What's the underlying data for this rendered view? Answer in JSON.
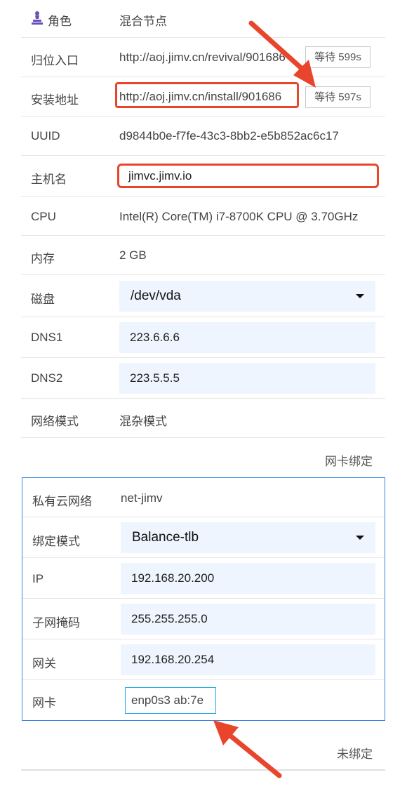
{
  "role": {
    "label": "角色",
    "value": "混合节点",
    "icon": "chess-piece-icon"
  },
  "revival": {
    "label": "归位入口",
    "url": "http://aoj.jimv.cn/revival/901686",
    "wait_label": "等待 599s"
  },
  "install": {
    "label": "安装地址",
    "url": "http://aoj.jimv.cn/install/901686",
    "wait_label": "等待 597s"
  },
  "uuid": {
    "label": "UUID",
    "value": "d9844b0e-f7fe-43c3-8bb2-e5b852ac6c17"
  },
  "hostname": {
    "label": "主机名",
    "value": "jimvc.jimv.io"
  },
  "cpu": {
    "label": "CPU",
    "value": "Intel(R) Core(TM) i7-8700K CPU @ 3.70GHz"
  },
  "memory": {
    "label": "内存",
    "value": "2 GB"
  },
  "disk": {
    "label": "磁盘",
    "value": "/dev/vda"
  },
  "dns1": {
    "label": "DNS1",
    "value": "223.6.6.6"
  },
  "dns2": {
    "label": "DNS2",
    "value": "223.5.5.5"
  },
  "network_mode": {
    "label": "网络模式",
    "value": "混杂模式"
  },
  "bind_nic_link": "网卡绑定",
  "bond": {
    "private_network": {
      "label": "私有云网络",
      "value": "net-jimv"
    },
    "bond_mode": {
      "label": "绑定模式",
      "value": "Balance-tlb"
    },
    "ip": {
      "label": "IP",
      "value": "192.168.20.200"
    },
    "netmask": {
      "label": "子网掩码",
      "value": "255.255.255.0"
    },
    "gateway": {
      "label": "网关",
      "value": "192.168.20.254"
    },
    "nic": {
      "label": "网卡",
      "value": "enp0s3 ab:7e"
    }
  },
  "unbound_label": "未绑定",
  "colors": {
    "accent_blue": "#3a84e4",
    "highlight_red": "#e8452c",
    "field_bg": "#eef5fe",
    "nic_border": "#22aee8"
  }
}
